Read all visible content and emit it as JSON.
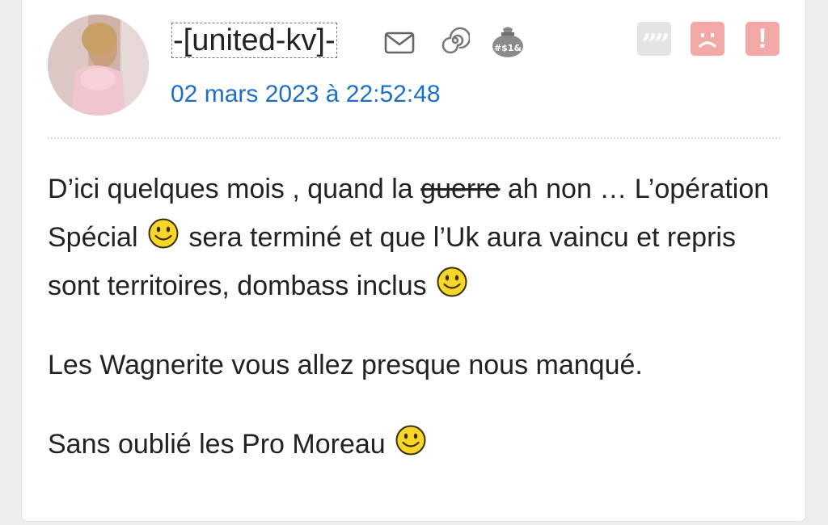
{
  "post": {
    "author": "-[united-kv]-",
    "date": "02 mars 2023 à 22:52:48",
    "icons": {
      "message": "mail-icon",
      "history": "spiral-icon",
      "badge": "money-bag-icon",
      "quote": "quote-icon",
      "blacklist": "sad-face-icon",
      "report": "alert-icon"
    },
    "colors": {
      "date": "#1d6fc5",
      "quote_button": "#d9d9d9",
      "action_buttons": "#f3a8a8"
    },
    "badge_text": "#$1&",
    "quote_glyph": "””",
    "report_glyph": "!",
    "body": {
      "p1_a": "D’ici quelques mois , quand la ",
      "p1_strike": "guerre",
      "p1_b": " ah non … L’opération Spécial ",
      "p1_c": " sera terminé et que l’Uk aura vaincu et repris sont territoires, dombass inclus ",
      "p2": "Les Wagnerite vous allez presque nous manqué.",
      "p3": "Sans oublié les Pro Moreau "
    },
    "smiley_icon": "smiley-icon"
  }
}
